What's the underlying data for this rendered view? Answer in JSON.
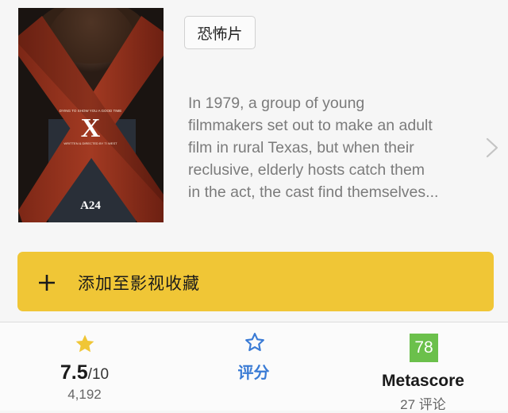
{
  "poster": {
    "tagline": "DYING TO SHOW YOU A GOOD TIME",
    "title_mark": "X",
    "credit": "WRITTEN & DIRECTED BY TI WEST",
    "studio": "A24"
  },
  "genre_chip": "恐怖片",
  "synopsis": {
    "lines": [
      "In 1979, a group of young",
      "filmmakers set out to make an adult",
      "film in rural Texas, but when their",
      "reclusive, elderly hosts catch them",
      "in the act, the cast find themselves..."
    ]
  },
  "watchlist": {
    "label": "添加至影视收藏"
  },
  "rating": {
    "value": "7.5",
    "max": "/10",
    "count": "4,192"
  },
  "rate": {
    "label": "评分"
  },
  "metascore": {
    "score": "78",
    "label": "Metascore",
    "reviews": "27 评论"
  },
  "colors": {
    "accent": "#f0c636",
    "link": "#3a7bd5",
    "metascore": "#6bc04b",
    "star": "#f0c636"
  }
}
